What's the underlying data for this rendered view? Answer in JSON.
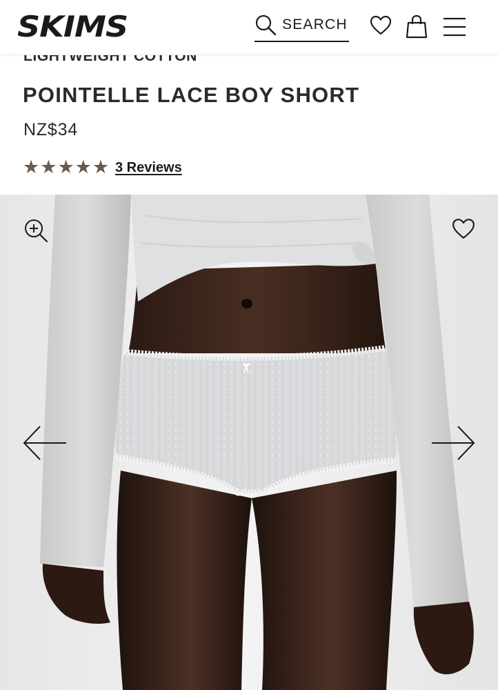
{
  "header": {
    "brand": "SKIMS",
    "search_label": "SEARCH"
  },
  "product": {
    "subtitle": "LIGHTWEIGHT COTTON",
    "title": "POINTELLE LACE BOY SHORT",
    "price": "NZ$34",
    "rating_stars": 5,
    "reviews_label": "3 Reviews"
  },
  "icons": {
    "search": "search-icon",
    "wishlist": "heart-icon",
    "bag": "shopping-bag-icon",
    "menu": "hamburger-menu-icon",
    "zoom": "zoom-in-icon",
    "prev": "arrow-left-icon",
    "next": "arrow-right-icon"
  },
  "colors": {
    "star": "#6b5a4e",
    "text": "#2a2a2a",
    "gallery_bg": "#ececec"
  }
}
